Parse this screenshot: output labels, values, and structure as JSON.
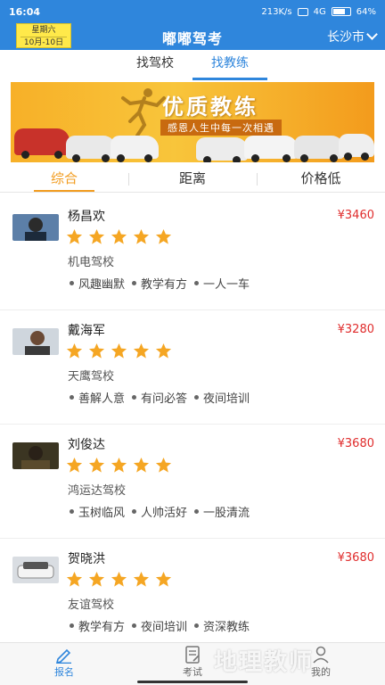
{
  "status_bar": {
    "time": "16:04",
    "network_speed": "213K/s",
    "signal": "4G",
    "battery": "64"
  },
  "header": {
    "weekday": "星期六",
    "date_range": "10月-10日",
    "title": "嘟嘟驾考",
    "city": "长沙市",
    "accent_color": "#2f86dc"
  },
  "top_tabs": [
    {
      "label": "找驾校",
      "active": false
    },
    {
      "label": "找教练",
      "active": true
    }
  ],
  "banner": {
    "title": "优质教练",
    "subtitle": "感恩人生中每一次相遇"
  },
  "sort_tabs": [
    {
      "label": "综合",
      "active": true
    },
    {
      "label": "距离",
      "active": false
    },
    {
      "label": "价格低",
      "active": false
    }
  ],
  "coaches": [
    {
      "name": "杨昌欢",
      "price": "¥3460",
      "rating": 5,
      "school": "机电驾校",
      "tags": [
        "风趣幽默",
        "教学有方",
        "一人一车"
      ]
    },
    {
      "name": "戴海军",
      "price": "¥3280",
      "rating": 5,
      "school": "天鹰驾校",
      "tags": [
        "善解人意",
        "有问必答",
        "夜间培训"
      ]
    },
    {
      "name": "刘俊达",
      "price": "¥3680",
      "rating": 5,
      "school": "鸿运达驾校",
      "tags": [
        "玉树临风",
        "人帅活好",
        "一股清流"
      ]
    },
    {
      "name": "贺晓洪",
      "price": "¥3680",
      "rating": 5,
      "school": "友谊驾校",
      "tags": [
        "教学有方",
        "夜间培训",
        "资深教练"
      ]
    }
  ],
  "bottom_nav": [
    {
      "label": "报名",
      "icon": "pen-icon",
      "active": true
    },
    {
      "label": "考试",
      "icon": "exam-icon",
      "active": false
    },
    {
      "label": "我的",
      "icon": "user-icon",
      "active": false
    }
  ],
  "watermark": "地理教师",
  "colors": {
    "price": "#e02d2d",
    "sort_active": "#f29c1f",
    "star": "#f5a623"
  }
}
